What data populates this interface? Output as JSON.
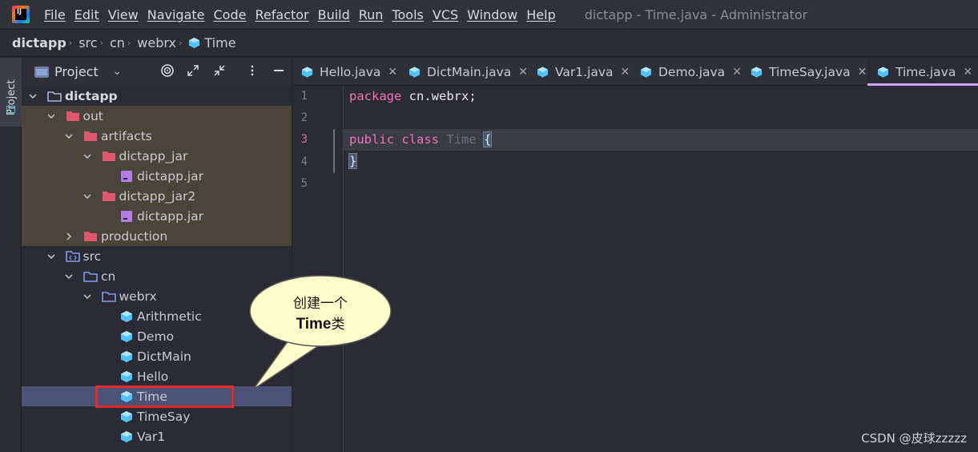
{
  "menubar": {
    "items": [
      "File",
      "Edit",
      "View",
      "Navigate",
      "Code",
      "Refactor",
      "Build",
      "Run",
      "Tools",
      "VCS",
      "Window",
      "Help"
    ],
    "window_title": "dictapp - Time.java - Administrator"
  },
  "breadcrumb": [
    "dictapp",
    "src",
    "cn",
    "webrx",
    "Time"
  ],
  "tool_strip": {
    "project_tab": "Project"
  },
  "project_panel": {
    "title": "Project",
    "tree": [
      {
        "label": "dictapp",
        "depth": 0,
        "expanded": true,
        "icon": "module-folder-icon",
        "bold": true
      },
      {
        "label": "out",
        "depth": 1,
        "expanded": true,
        "icon": "excluded-folder-icon",
        "excluded": true
      },
      {
        "label": "artifacts",
        "depth": 2,
        "expanded": true,
        "icon": "excluded-folder-icon",
        "excluded": true
      },
      {
        "label": "dictapp_jar",
        "depth": 3,
        "expanded": true,
        "icon": "excluded-folder-icon",
        "excluded": true
      },
      {
        "label": "dictapp.jar",
        "depth": 4,
        "icon": "jar-icon",
        "excluded": true
      },
      {
        "label": "dictapp_jar2",
        "depth": 3,
        "expanded": true,
        "icon": "excluded-folder-icon",
        "excluded": true
      },
      {
        "label": "dictapp.jar",
        "depth": 4,
        "icon": "jar-icon",
        "excluded": true
      },
      {
        "label": "production",
        "depth": 2,
        "expanded": false,
        "icon": "excluded-folder-icon",
        "excluded": true
      },
      {
        "label": "src",
        "depth": 1,
        "expanded": true,
        "icon": "source-folder-icon"
      },
      {
        "label": "cn",
        "depth": 2,
        "expanded": true,
        "icon": "package-folder-icon"
      },
      {
        "label": "webrx",
        "depth": 3,
        "expanded": true,
        "icon": "package-folder-icon"
      },
      {
        "label": "Arithmetic",
        "depth": 4,
        "icon": "java-class-icon"
      },
      {
        "label": "Demo",
        "depth": 4,
        "icon": "java-class-icon"
      },
      {
        "label": "DictMain",
        "depth": 4,
        "icon": "java-class-icon"
      },
      {
        "label": "Hello",
        "depth": 4,
        "icon": "java-class-icon"
      },
      {
        "label": "Time",
        "depth": 4,
        "icon": "java-class-icon",
        "selected": true
      },
      {
        "label": "TimeSay",
        "depth": 4,
        "icon": "java-class-icon"
      },
      {
        "label": "Var1",
        "depth": 4,
        "icon": "java-class-icon"
      }
    ]
  },
  "tabs": [
    {
      "label": "Hello.java",
      "active": false
    },
    {
      "label": "DictMain.java",
      "active": false
    },
    {
      "label": "Var1.java",
      "active": false
    },
    {
      "label": "Demo.java",
      "active": false
    },
    {
      "label": "TimeSay.java",
      "active": false
    },
    {
      "label": "Time.java",
      "active": true
    }
  ],
  "editor": {
    "line_numbers": [
      "1",
      "2",
      "3",
      "4",
      "5"
    ],
    "current_line": "3",
    "line1": {
      "keyword": "package",
      "package_name": "cn.webrx;"
    },
    "line3": {
      "kw1": "public",
      "kw2": "class",
      "class_name": "Time",
      "brace": "{"
    },
    "line4": {
      "brace": "}"
    }
  },
  "callout": {
    "line1": "创建一个",
    "line2_bold": "Time",
    "line2_rest": "类"
  },
  "watermark": "CSDN @皮球zzzzz",
  "colors": {
    "accent_tab_underline": "#c9a3ff",
    "keyword": "#f472b6",
    "excluded_bg": "#4a453a",
    "selected_bg": "#4a5276",
    "highlight_border": "#e52a2a",
    "callout_fill": "#ffffcc"
  }
}
